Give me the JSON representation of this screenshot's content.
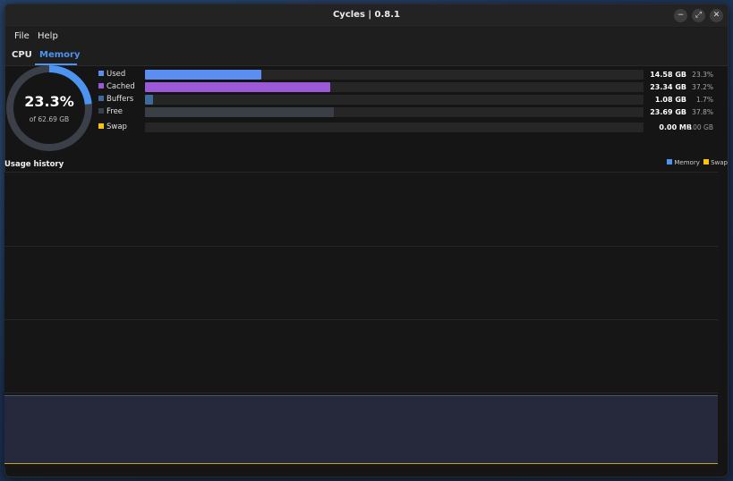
{
  "window": {
    "title": "Cycles | 0.8.1",
    "controls": {
      "minimize": "−",
      "maximize": "⤢",
      "close": "✕"
    }
  },
  "menu": {
    "items": [
      "File",
      "Help"
    ]
  },
  "tabs": [
    {
      "label": "CPU",
      "active": false
    },
    {
      "label": "Memory",
      "active": true
    }
  ],
  "summary": {
    "percent_label": "23.3%",
    "percent_value": 23.3,
    "total_label": "of 62.69 GB",
    "ring_color": "#4c94f0",
    "ring_track_color": "#3a3f48"
  },
  "memory_rows": [
    {
      "label": "Used",
      "value": "14.58 GB",
      "percent": "23.3%",
      "fraction": 0.233,
      "color": "#5b8ef0"
    },
    {
      "label": "Cached",
      "value": "23.34 GB",
      "percent": "37.2%",
      "fraction": 0.372,
      "color": "#9b59d8"
    },
    {
      "label": "Buffers",
      "value": "1.08 GB",
      "percent": "1.7%",
      "fraction": 0.017,
      "color": "#3f6b9a"
    },
    {
      "label": "Free",
      "value": "23.69 GB",
      "percent": "37.8%",
      "fraction": 0.378,
      "color": "#3a3e45"
    }
  ],
  "swap_row": {
    "label": "Swap",
    "value": "0.00 MB",
    "total": "/ 2.00 GB",
    "fraction": 0,
    "color": "#f5c211"
  },
  "history": {
    "title": "Usage history",
    "legend": [
      {
        "label": "Memory",
        "color": "#4c94f0"
      },
      {
        "label": "Swap",
        "color": "#f5c211"
      }
    ],
    "memory_level": 0.233,
    "swap_level": 0
  }
}
